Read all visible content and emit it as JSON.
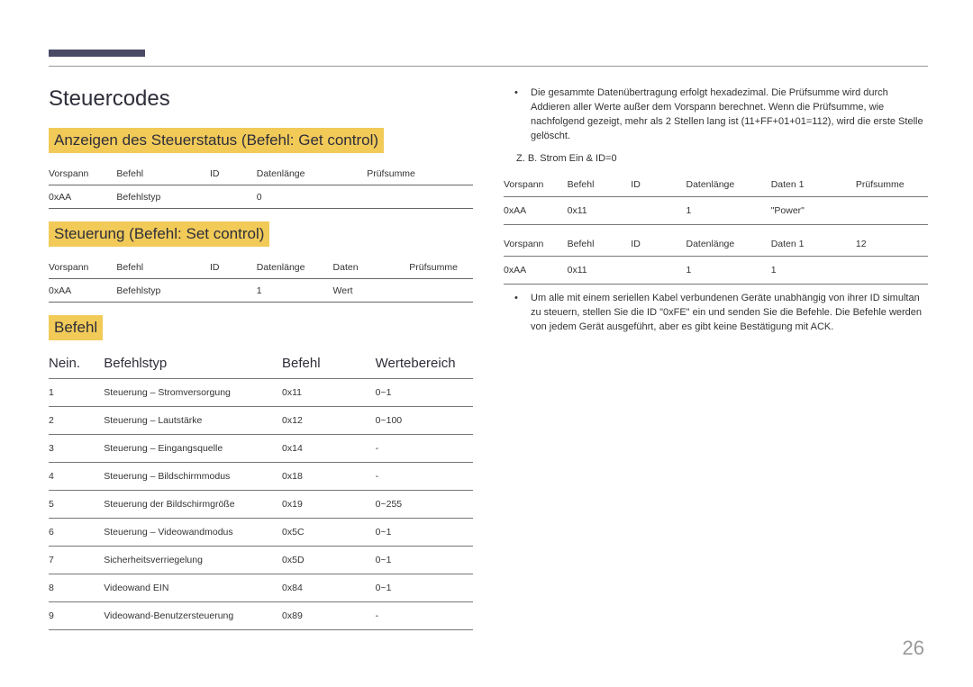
{
  "page_number": "26",
  "heading": "Steuercodes",
  "sections": {
    "get": {
      "title": "Anzeigen des Steuerstatus (Befehl: Get control)",
      "headers": [
        "Vorspann",
        "Befehl",
        "ID",
        "Datenlänge",
        "Prüfsumme"
      ],
      "row": [
        "0xAA",
        "Befehlstyp",
        "",
        "0",
        ""
      ]
    },
    "set": {
      "title": "Steuerung (Befehl: Set control)",
      "headers": [
        "Vorspann",
        "Befehl",
        "ID",
        "Datenlänge",
        "Daten",
        "Prüfsumme"
      ],
      "row": [
        "0xAA",
        "Befehlstyp",
        "",
        "1",
        "Wert",
        ""
      ]
    },
    "cmd": {
      "title": "Befehl",
      "headers": [
        "Nein.",
        "Befehlstyp",
        "Befehl",
        "Wertebereich"
      ],
      "rows": [
        [
          "1",
          "Steuerung – Stromversorgung",
          "0x11",
          "0~1"
        ],
        [
          "2",
          "Steuerung – Lautstärke",
          "0x12",
          "0~100"
        ],
        [
          "3",
          "Steuerung – Eingangsquelle",
          "0x14",
          "-"
        ],
        [
          "4",
          "Steuerung – Bildschirmmodus",
          "0x18",
          "-"
        ],
        [
          "5",
          "Steuerung der Bildschirmgröße",
          "0x19",
          "0~255"
        ],
        [
          "6",
          "Steuerung – Videowandmodus",
          "0x5C",
          "0~1"
        ],
        [
          "7",
          "Sicherheitsverriegelung",
          "0x5D",
          "0~1"
        ],
        [
          "8",
          "Videowand EIN",
          "0x84",
          "0~1"
        ],
        [
          "9",
          "Videowand-Benutzersteuerung",
          "0x89",
          "-"
        ]
      ]
    }
  },
  "right": {
    "bullet1": "Die gesammte Datenübertragung erfolgt hexadezimal. Die Prüfsumme wird durch Addieren aller Werte außer dem Vorspann berechnet. Wenn die Prüfsumme, wie nachfolgend gezeigt, mehr als 2 Stellen lang ist (11+FF+01+01=112), wird die erste Stelle gelöscht.",
    "example_label": "Z. B. Strom Ein & ID=0",
    "table1": {
      "headers": [
        "Vorspann",
        "Befehl",
        "ID",
        "Datenlänge",
        "Daten 1",
        "Prüfsumme"
      ],
      "row": [
        "0xAA",
        "0x11",
        "",
        "1",
        "\"Power\"",
        ""
      ]
    },
    "table2": {
      "headers": [
        "Vorspann",
        "Befehl",
        "ID",
        "Datenlänge",
        "Daten 1",
        "12"
      ],
      "row": [
        "0xAA",
        "0x11",
        "",
        "1",
        "1",
        ""
      ]
    },
    "bullet2": "Um alle mit einem seriellen Kabel verbundenen Geräte unabhängig von ihrer ID simultan zu steuern, stellen Sie die ID \"0xFE\" ein und senden Sie die Befehle. Die Befehle werden von jedem Gerät ausgeführt, aber es gibt keine Bestätigung mit ACK."
  }
}
